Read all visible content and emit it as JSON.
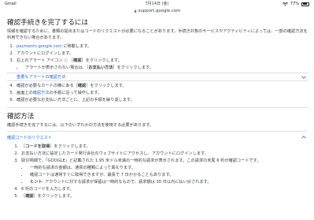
{
  "status_bar": {
    "left": "Gmail",
    "date": "7月14日 (金)",
    "battery": "77%",
    "battery_level": 0.77
  },
  "address_bar": {
    "url": "support.google.com"
  },
  "section1": {
    "title": "確認手続きを完了するには",
    "intro": "情報を確認するために、書類の提出またはコードのリクエストが必要になることがあります。手続き対象のサービスやアクティビティによっては、一部の確認方法を利用できない場合があります。",
    "steps": {
      "s1_link": "payments.google.com",
      "s1_rest": " に移動します。",
      "s2": "アカウントにログインします。",
      "s3_a": "右上のアラート アイコン ",
      "s3_icon": "ⓘ",
      "s3_b": " ［",
      "s3_bold": "確認",
      "s3_c": "］をクリックします。",
      "s3_sub_a": "アラートが表示されない場合は、［",
      "s3_sub_bold": "お支払い方法",
      "s3_sub_b": "］をクリックします。"
    },
    "expander": "重要なアラートの確認方法",
    "steps2": {
      "s4_a": "確認が必要なカードの横にある［",
      "s4_bold": "確認",
      "s4_b": "］をクリックします。",
      "s5_a": "画面上の",
      "s5_link": "確認方法",
      "s5_b": "の手順に沿って操作します。",
      "s6": "確認が必要なお支払い方法ごとに、上記の手順を繰り返します。"
    }
  },
  "section2": {
    "title": "確認方法",
    "intro": "確認手続きを完了するには、以下のいずれかの方法を使用する必要があります。",
    "expander": "確認コードのリクエスト",
    "steps": {
      "s1_a": "［",
      "s1_bold": "コードを取得",
      "s1_b": "］をクリックします。",
      "s2": "お支払い方法に設定したカード発行会社のウェブサイトにアクセスし、アカウントにログインします。",
      "s3": "取引明細で、「GOOGLE」と記載された 1.95 米ドル未満の一時的な請求が表示されます。この請求の末尾 6 桁が確認コードです。",
      "sub1": "一時的な請求の金額は、通貨の種類によって異なります。",
      "sub2": "確認コードは通常すぐに取得できますが、最長で 7 日かかることもあります。",
      "sub3_bold": "ヒント",
      "sub3_rest": ": アカウントに対する請求が保留は一時的なもので、請求額は 30 日以内に払い戻されます。",
      "s4": "6 桁のコードを入力します。",
      "s5_a": "［",
      "s5_bold": "確認",
      "s5_b": "］をクリックします。"
    }
  }
}
